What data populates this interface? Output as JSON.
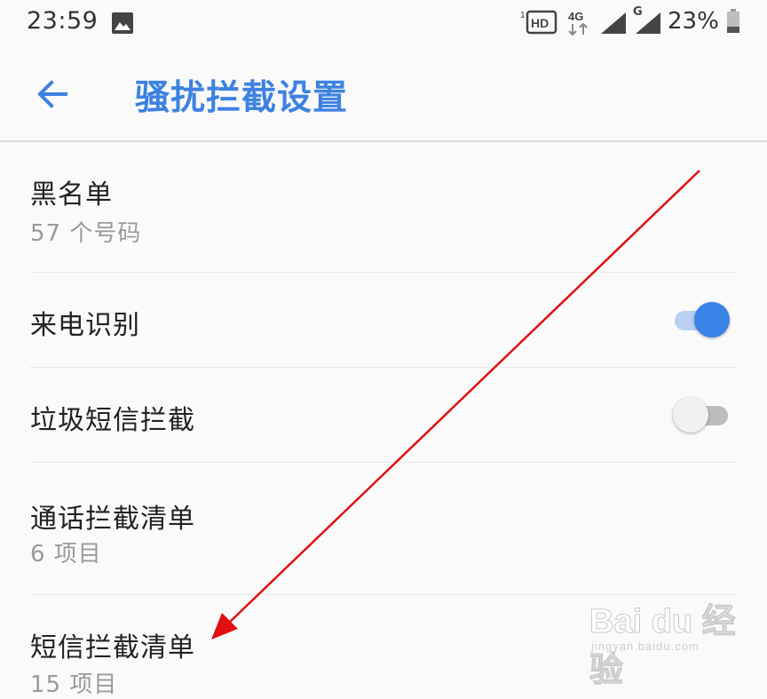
{
  "status_bar": {
    "time": "23:59",
    "hd_label": "HD",
    "hd_slot": "1",
    "network_type": "4G",
    "network_type_2": "G",
    "battery_percent": "23%",
    "icons": [
      "gallery-icon",
      "hd-voice-icon",
      "4g-data-icon",
      "signal-icon",
      "signal-icon",
      "battery-icon"
    ]
  },
  "app_bar": {
    "title": "骚扰拦截设置",
    "back_icon": "arrow-left-icon",
    "accent_color": "#3d82e0"
  },
  "settings": {
    "blacklist": {
      "title": "黑名单",
      "subtitle": "57 个号码"
    },
    "caller_id": {
      "title": "来电识别",
      "enabled": true
    },
    "spam_sms": {
      "title": "垃圾短信拦截",
      "enabled": false
    },
    "call_block_list": {
      "title": "通话拦截清单",
      "subtitle": "6 项目"
    },
    "sms_block_list": {
      "title": "短信拦截清单",
      "subtitle": "15 项目"
    }
  },
  "annotation": {
    "arrow_color": "#e01010"
  },
  "watermark": {
    "main": "Bai du 经验",
    "sub": "jingyan.baidu.com"
  }
}
